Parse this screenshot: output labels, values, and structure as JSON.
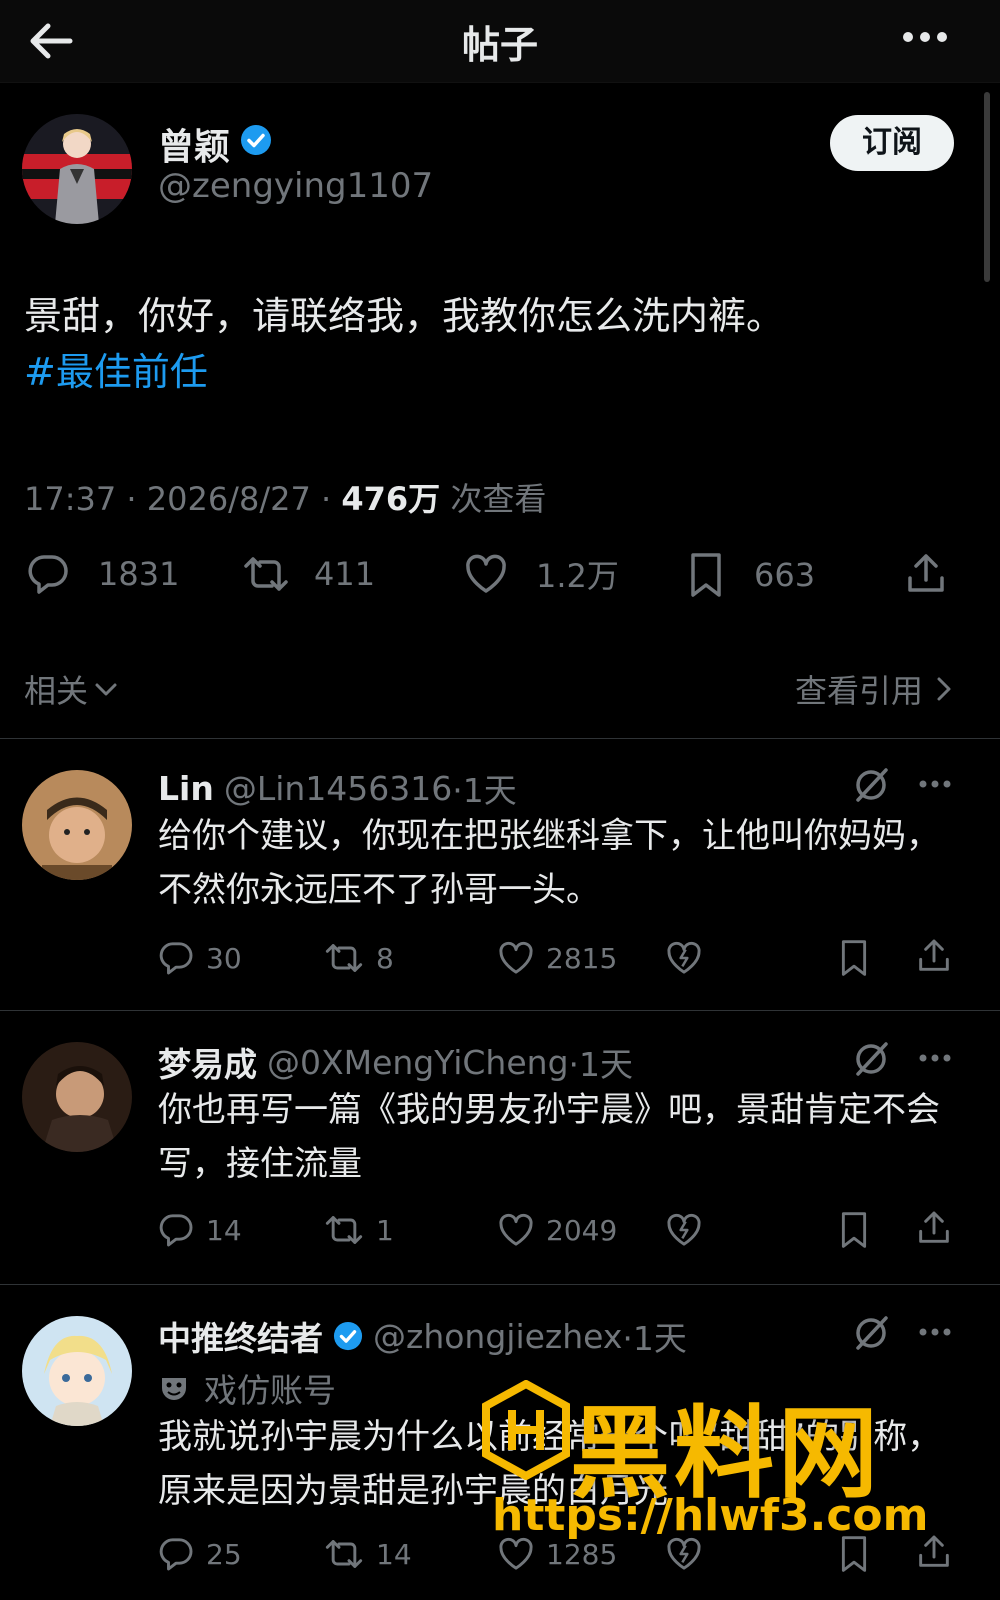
{
  "header": {
    "title": "帖子"
  },
  "post": {
    "author_name": "曾颖",
    "author_handle": "@zengying1107",
    "subscribe_label": "订阅",
    "text": "景甜，你好，请联络我，我教你怎么洗内裤。",
    "hashtag": "#最佳前任",
    "time": "17:37 · 2026/8/27 · ",
    "views_count": "476万",
    "views_label": " 次查看",
    "stats": {
      "replies": "1831",
      "reposts": "411",
      "likes": "1.2万",
      "bookmarks": "663"
    },
    "related_label": "相关",
    "view_quotes_label": "查看引用"
  },
  "replies": [
    {
      "name": "Lin",
      "handle": "@Lin1456316",
      "time": "·1天",
      "text": "给你个建议，你现在把张继科拿下，让他叫你妈妈，不然你永远压不了孙哥一头。",
      "replies": "30",
      "reposts": "8",
      "likes": "2815"
    },
    {
      "name": "梦易成",
      "handle": "@0XMengYiCheng",
      "time": "·1天",
      "text": "你也再写一篇《我的男友孙宇晨》吧，景甜肯定不会写，接住流量",
      "replies": "14",
      "reposts": "1",
      "likes": "2049"
    },
    {
      "name": "中推终结者",
      "handle": "@zhongjiezhex",
      "time": "·1天",
      "parody_label": "戏仿账号",
      "text": "我就说孙宇晨为什么以前经常一个叫“甜甜”的别称，原来是因为景甜是孙宇晨的白月光",
      "replies": "25",
      "reposts": "14",
      "likes": "1285"
    }
  ],
  "watermark": {
    "text": "黑料网",
    "url": "https://hlwf3.com"
  },
  "colors": {
    "accent": "#1d9bf0",
    "muted": "#71767b",
    "watermark": "#f6b900"
  }
}
